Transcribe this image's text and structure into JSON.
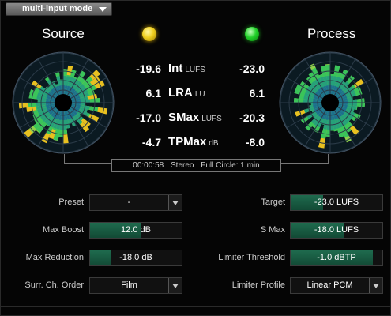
{
  "toolbar": {
    "mode_label": "multi-input mode"
  },
  "meter": {
    "source_title": "Source",
    "process_title": "Process",
    "source_led_color": "#f0d020",
    "process_led_color": "#22d22a",
    "metrics": [
      {
        "source": "-19.6",
        "name": "Int",
        "unit": "LUFS",
        "process": "-23.0"
      },
      {
        "source": "6.1",
        "name": "LRA",
        "unit": "LU",
        "process": "6.1"
      },
      {
        "source": "-17.0",
        "name": "SMax",
        "unit": "LUFS",
        "process": "-20.3"
      },
      {
        "source": "-4.7",
        "name": "TPMax",
        "unit": "dB",
        "process": "-8.0"
      }
    ],
    "elapsed": "00:00:58",
    "channel_format": "Stereo",
    "circle_mode": "Full Circle: 1 min"
  },
  "controls": {
    "preset": {
      "label": "Preset",
      "value": "-"
    },
    "max_boost": {
      "label": "Max Boost",
      "value": "12.0 dB",
      "fill": 0.55
    },
    "max_reduction": {
      "label": "Max Reduction",
      "value": "-18.0 dB",
      "fill": 0.22
    },
    "surr_order": {
      "label": "Surr. Ch. Order",
      "value": "Film"
    },
    "target": {
      "label": "Target",
      "value": "-23.0 LUFS",
      "fill": 0.35
    },
    "s_max": {
      "label": "S Max",
      "value": "-18.0 LUFS",
      "fill": 0.58
    },
    "limiter_threshold": {
      "label": "Limiter Threshold",
      "value": "-1.0 dBTP",
      "fill": 0.9
    },
    "limiter_profile": {
      "label": "Limiter Profile",
      "value": "Linear PCM"
    }
  },
  "colors": {
    "accent_fill": "#1f6b4e",
    "radar_inner": "#1a6a8a",
    "radar_mid": "#2ab85a",
    "radar_outer": "#e8c020"
  }
}
